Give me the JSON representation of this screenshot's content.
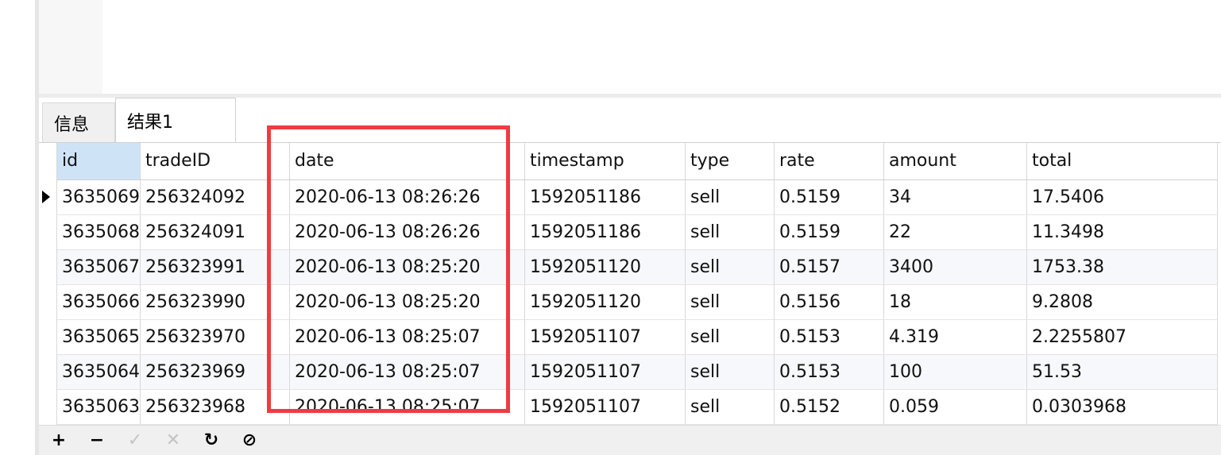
{
  "tabs": [
    {
      "label": "信息"
    },
    {
      "label": "结果1"
    }
  ],
  "grid": {
    "columns": [
      "id",
      "tradeID",
      "date",
      "timestamp",
      "type",
      "rate",
      "amount",
      "total"
    ],
    "rows": [
      [
        "3635069",
        "256324092",
        "2020-06-13 08:26:26",
        "1592051186",
        "sell",
        "0.5159",
        "34",
        "17.5406"
      ],
      [
        "3635068",
        "256324091",
        "2020-06-13 08:26:26",
        "1592051186",
        "sell",
        "0.5159",
        "22",
        "11.3498"
      ],
      [
        "3635067",
        "256323991",
        "2020-06-13 08:25:20",
        "1592051120",
        "sell",
        "0.5157",
        "3400",
        "1753.38"
      ],
      [
        "3635066",
        "256323990",
        "2020-06-13 08:25:20",
        "1592051120",
        "sell",
        "0.5156",
        "18",
        "9.2808"
      ],
      [
        "3635065",
        "256323970",
        "2020-06-13 08:25:07",
        "1592051107",
        "sell",
        "0.5153",
        "4.319",
        "2.2255807"
      ],
      [
        "3635064",
        "256323969",
        "2020-06-13 08:25:07",
        "1592051107",
        "sell",
        "0.5153",
        "100",
        "51.53"
      ],
      [
        "3635063",
        "256323968",
        "2020-06-13 08:25:07",
        "1592051107",
        "sell",
        "0.5152",
        "0.059",
        "0.0303968"
      ]
    ]
  },
  "toolbar": {
    "add": "+",
    "remove": "−",
    "apply": "✓",
    "discard": "✕",
    "refresh": "↻",
    "stop": "⊘"
  },
  "colors": {
    "highlight": "#ef3b42",
    "active_header": "#cfe3f7"
  }
}
